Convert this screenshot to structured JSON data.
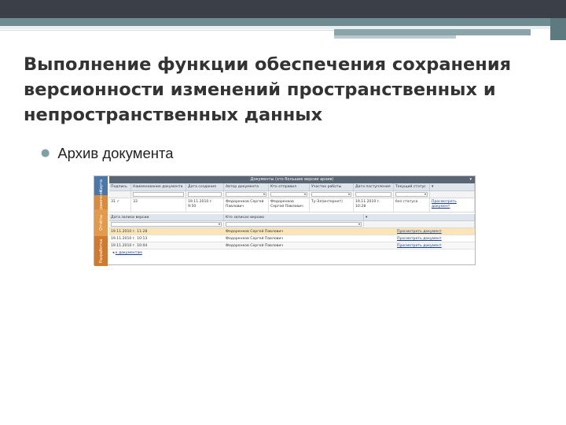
{
  "slide": {
    "title": "Выполнение функции обеспечения сохранения версионности изменений пространственных и непространственных данных",
    "bullet": "Архив документа"
  },
  "screenshot": {
    "side_tabs": [
      "Карта",
      "Справочник",
      "Отчёты",
      "Разработка"
    ],
    "panel_title": "Документы (это большие версии архив)",
    "panel_pin": "▾",
    "columns": [
      "Подпись",
      "Наименование документа",
      "Дата создания",
      "Автор документа",
      "Кто отправил",
      "Участок работы",
      "Дата поступления",
      "Текущий статус",
      "▾"
    ],
    "rows": [
      {
        "num": "31",
        "flag": "✓",
        "name": "33",
        "created": "19.11.2010 г. 9:50",
        "author": "Федоренков Сергей Павлович",
        "sender": "Федоренков Сергей Павлович",
        "area": "Ту-Эл(интернет)",
        "received": "19.11.2010 г. 10:28",
        "status": "без статуса",
        "action": "Просмотреть документ"
      }
    ],
    "versions": {
      "columns": [
        "Дата записи версии",
        "Кто записал версию",
        "▾"
      ],
      "rows": [
        {
          "date": "19.11.2010 г. 11:28",
          "user": "Федоренков Сергей Павлович",
          "action": "Просмотреть документ"
        },
        {
          "date": "19.11.2010 г. 10:13",
          "user": "Федоренков Сергей Павлович",
          "action": "Просмотреть документ"
        },
        {
          "date": "19.11.2010 г. 10:04",
          "user": "Федоренков Сергей Павлович",
          "action": "Просмотреть документ"
        }
      ],
      "back_link": "к документам"
    }
  },
  "colors": {
    "title": "#333333",
    "accent_teal": "#6f8c93",
    "selected_row": "#fbe5b6"
  }
}
